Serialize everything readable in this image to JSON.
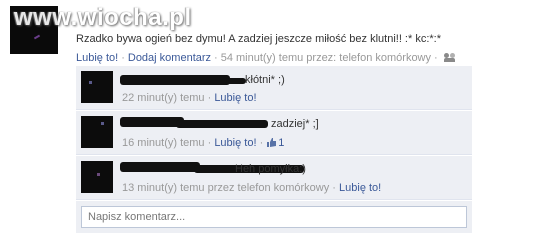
{
  "watermark": "www.wiocha.pl",
  "post": {
    "text": "Rzadko bywa ogień bez dymu! A zadziej jeszcze miłość bez klutni!! :* kc:*:*",
    "like_label": "Lubię to!",
    "comment_label": "Dodaj komentarz",
    "meta": "54 minut(y) temu przez: telefon komórkowy",
    "privacy_icon": "friends-icon"
  },
  "comments": [
    {
      "text_visible": "kłótni* ;)",
      "time": "22 minut(y) temu",
      "like_label": "Lubię to!",
      "likes": ""
    },
    {
      "text_visible": "zadziej* ;]",
      "time": "16 minut(y) temu",
      "like_label": "Lubię to!",
      "likes": "1"
    },
    {
      "text_visible": "Heh pomyłka:)",
      "time": "13 minut(y) temu przez telefon komórkowy",
      "like_label": "Lubię to!",
      "likes": ""
    }
  ],
  "input": {
    "placeholder": "Napisz komentarz..."
  },
  "colors": {
    "link": "#3b5998",
    "comment_bg": "#edeff4",
    "meta": "#999999"
  }
}
